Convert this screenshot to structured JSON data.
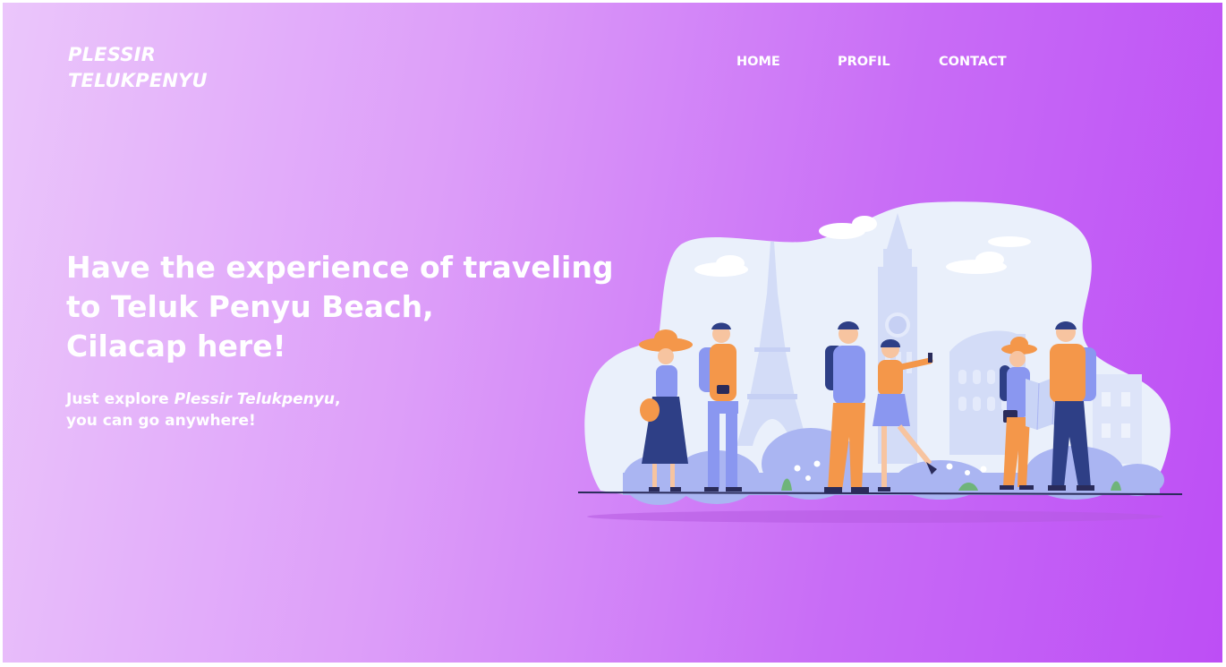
{
  "brand": {
    "line1": "PLESSIR",
    "line2": "TELUKPENYU"
  },
  "nav": {
    "home": "HOME",
    "profil": "PROFIL",
    "contact": "CONTACT"
  },
  "hero": {
    "title_line1": "Have the experience of traveling",
    "title_line2": "to Teluk Penyu Beach,",
    "title_line3": "Cilacap here!",
    "sub_prefix": "Just explore ",
    "sub_brand": "Plessir Telukpenyu",
    "sub_suffix": ",",
    "sub_line2": "you can go anywhere!"
  },
  "illustration": {
    "icon": "travelers-illustration"
  },
  "colors": {
    "gradient_start": "#ebc6fb",
    "gradient_end": "#bd4ef5",
    "text": "#ffffff",
    "accent_orange": "#f4974a",
    "accent_blue": "#8a97f0"
  }
}
